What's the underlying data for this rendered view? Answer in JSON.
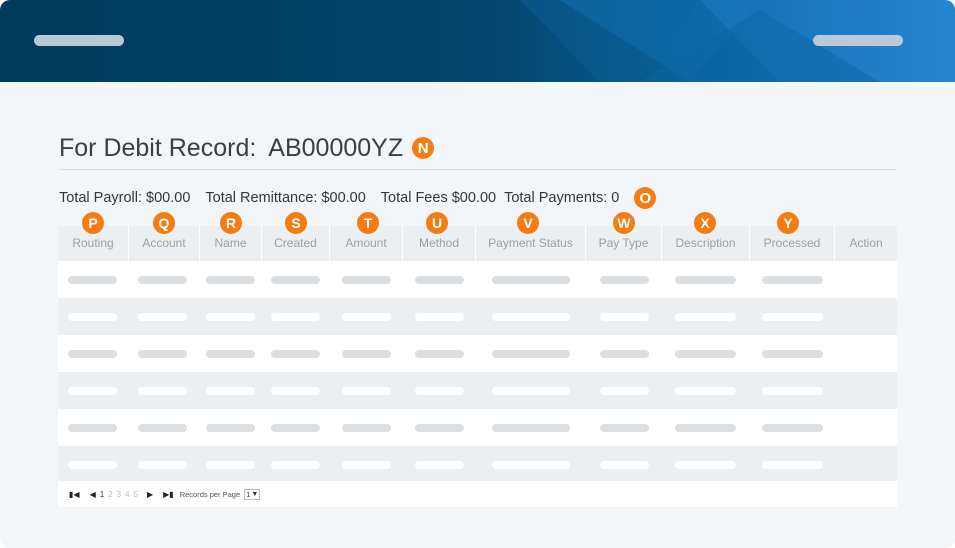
{
  "record": {
    "title_label": "For Debit Record:",
    "record_id": "AB00000YZ",
    "marker": "N"
  },
  "totals": {
    "payroll": "Total Payroll: $00.00",
    "remittance": "Total Remittance: $00.00",
    "fees": "Total Fees $00.00",
    "payments": "Total Payments: 0",
    "marker": "O"
  },
  "table": {
    "columns": [
      {
        "label": "Routing",
        "marker": "P"
      },
      {
        "label": "Account",
        "marker": "Q"
      },
      {
        "label": "Name",
        "marker": "R"
      },
      {
        "label": "Created",
        "marker": "S"
      },
      {
        "label": "Amount",
        "marker": "T"
      },
      {
        "label": "Method",
        "marker": "U"
      },
      {
        "label": "Payment Status",
        "marker": "V"
      },
      {
        "label": "Pay Type",
        "marker": "W"
      },
      {
        "label": "Description",
        "marker": "X"
      },
      {
        "label": "Processed",
        "marker": "Y"
      },
      {
        "label": "Action",
        "marker": ""
      }
    ]
  },
  "pagination": {
    "pages": [
      "1",
      "2",
      "3",
      "4",
      "5"
    ],
    "current_page": "1",
    "records_per_page_label": "Records per Page",
    "records_per_page_value": "1"
  },
  "colors": {
    "header_dark": "#013a5c",
    "header_light": "#2a8ad6",
    "badge": "#f47c13",
    "table_stripe": "#eceff2"
  }
}
